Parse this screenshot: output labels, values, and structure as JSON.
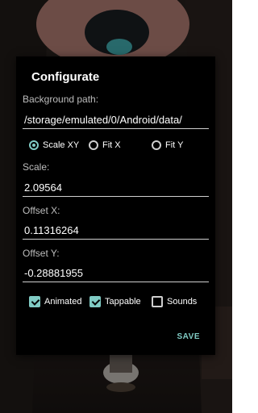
{
  "dialog": {
    "title": "Configurate",
    "background_path": {
      "label": "Background path:",
      "value": "/storage/emulated/0/Android/data/"
    },
    "scale_mode": {
      "options": [
        {
          "label": "Scale XY",
          "checked": true
        },
        {
          "label": "Fit X",
          "checked": false
        },
        {
          "label": "Fit Y",
          "checked": false
        }
      ]
    },
    "scale": {
      "label": "Scale:",
      "value": "2.09564"
    },
    "offset_x": {
      "label": "Offset X:",
      "value": "0.11316264"
    },
    "offset_y": {
      "label": "Offset Y:",
      "value": "-0.28881955"
    },
    "options": [
      {
        "label": "Animated",
        "checked": true
      },
      {
        "label": "Tappable",
        "checked": true
      },
      {
        "label": "Sounds",
        "checked": false
      }
    ],
    "save_label": "SAVE"
  },
  "colors": {
    "accent": "#80cbc4",
    "dialog_bg": "#000000",
    "text": "#ffffff",
    "label": "#bdbdbd"
  }
}
